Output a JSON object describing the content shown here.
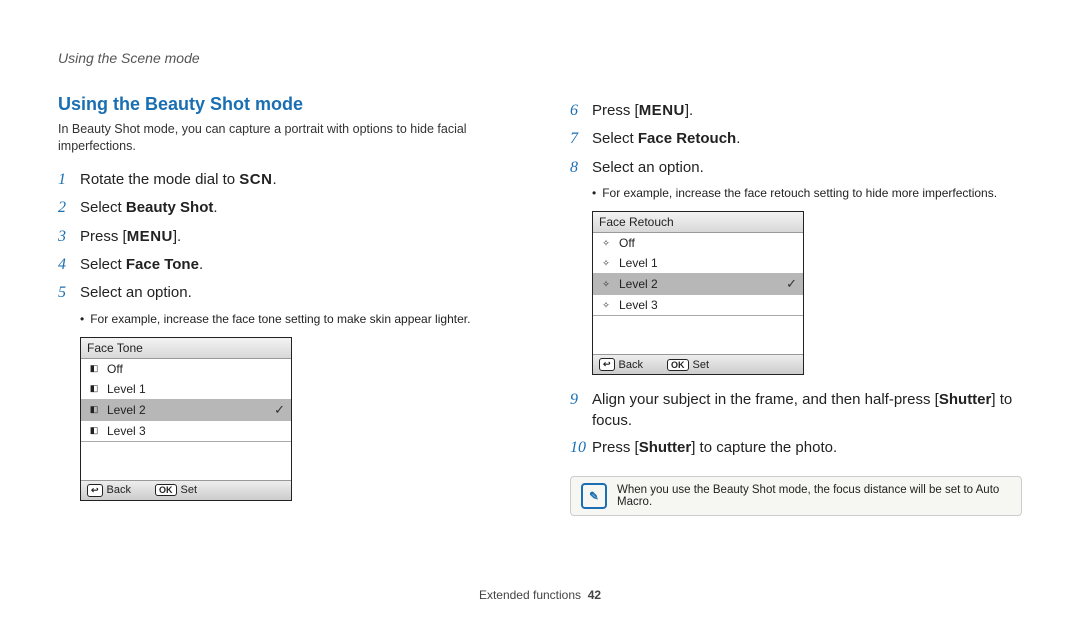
{
  "header": {
    "title": "Using the Scene mode"
  },
  "section": {
    "title": "Using the Beauty Shot mode",
    "intro": "In Beauty Shot mode, you can capture a portrait with options to hide facial imperfections."
  },
  "glyphs": {
    "scn": "SCN",
    "menu": "MENU"
  },
  "steps": {
    "1": {
      "pre": "Rotate the mode dial to ",
      "post": "."
    },
    "2": {
      "pre": "Select ",
      "bold": "Beauty Shot",
      "post": "."
    },
    "3": {
      "pre": "Press [",
      "post": "]."
    },
    "4": {
      "pre": "Select ",
      "bold": "Face Tone",
      "post": "."
    },
    "5": {
      "text": "Select an option."
    },
    "5sub": "For example, increase the face tone setting to make skin appear lighter.",
    "6": {
      "pre": "Press [",
      "post": "]."
    },
    "7": {
      "pre": "Select ",
      "bold": "Face Retouch",
      "post": "."
    },
    "8": {
      "text": "Select an option."
    },
    "8sub": "For example, increase the face retouch setting to hide more imperfections.",
    "9": {
      "pre": "Align your subject in the frame, and then half-press [",
      "bold": "Shutter",
      "post": "] to focus."
    },
    "10": {
      "pre": "Press [",
      "bold": "Shutter",
      "post": "] to capture the photo."
    }
  },
  "menu1": {
    "title": "Face Tone",
    "rows": [
      "Off",
      "Level 1",
      "Level 2",
      "Level 3"
    ],
    "selectedIndex": 2,
    "back": "Back",
    "set": "Set"
  },
  "menu2": {
    "title": "Face Retouch",
    "rows": [
      "Off",
      "Level 1",
      "Level 2",
      "Level 3"
    ],
    "selectedIndex": 2,
    "back": "Back",
    "set": "Set"
  },
  "note": "When you use the Beauty Shot mode, the focus distance will be set to Auto Macro.",
  "footer": {
    "section": "Extended functions",
    "page": "42"
  }
}
